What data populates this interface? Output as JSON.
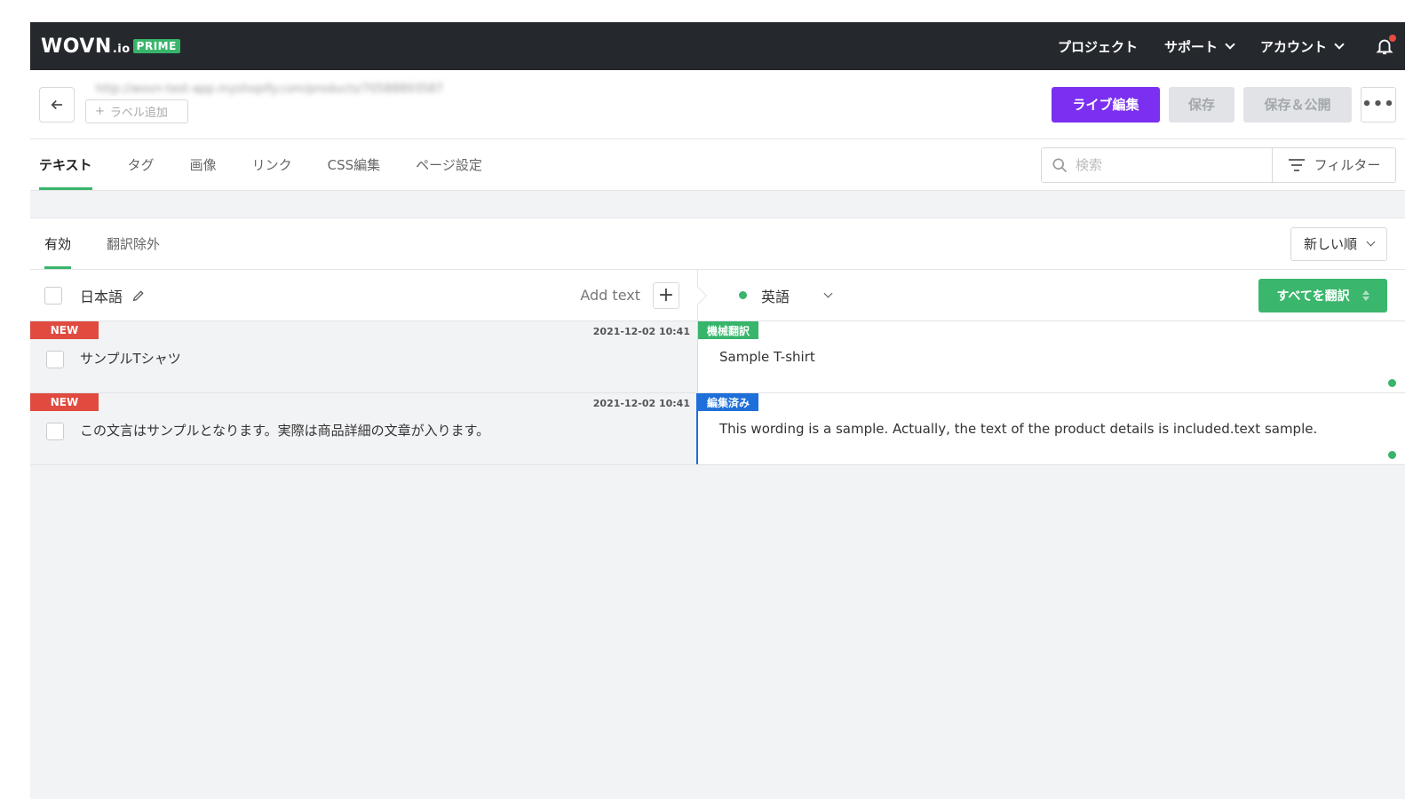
{
  "header": {
    "logo": {
      "main": "WOVN",
      "suffix": ".io",
      "badge": "PRIME"
    },
    "nav": [
      {
        "label": "プロジェクト",
        "dropdown": false
      },
      {
        "label": "サポート",
        "dropdown": true
      },
      {
        "label": "アカウント",
        "dropdown": true
      }
    ],
    "notification_icon": "bell-icon",
    "notification_dot_color": "#e74c3c"
  },
  "pagebar": {
    "url": "http://wovn-test-app.myshopify.com/products/70588893587",
    "label_add": "ラベル追加",
    "live_edit": "ライブ編集",
    "save": "保存",
    "save_publish": "保存＆公開",
    "more": "•••"
  },
  "tabs": [
    "テキスト",
    "タグ",
    "画像",
    "リンク",
    "CSS編集",
    "ページ設定"
  ],
  "active_tab": "テキスト",
  "search": {
    "placeholder": "検索",
    "filter_label": "フィルター"
  },
  "subtabs": [
    "有効",
    "翻訳除外"
  ],
  "active_subtab": "有効",
  "sort": {
    "selected": "新しい順"
  },
  "language_bar": {
    "source_lang": "日本語",
    "add_text": "Add text",
    "target_lang": "英語",
    "translate_all": "すべてを翻訳"
  },
  "rows": [
    {
      "badge": "NEW",
      "timestamp": "2021-12-02 10:41",
      "source": "サンプルTシャツ",
      "status": "機械翻訳",
      "translation": "Sample T-shirt"
    },
    {
      "badge": "NEW",
      "timestamp": "2021-12-02 10:41",
      "source": "この文言はサンプルとなります。実際は商品詳細の文章が入ります。",
      "status": "編集済み",
      "translation": "This wording is a sample. Actually, the text of the product details is included.text sample."
    }
  ],
  "colors": {
    "accent_green": "#38b56b",
    "live_edit_purple": "#7b2ff0",
    "new_badge_red": "#e04a3f",
    "edited_blue": "#1e6fd9",
    "topbar_dark": "#25292e"
  }
}
